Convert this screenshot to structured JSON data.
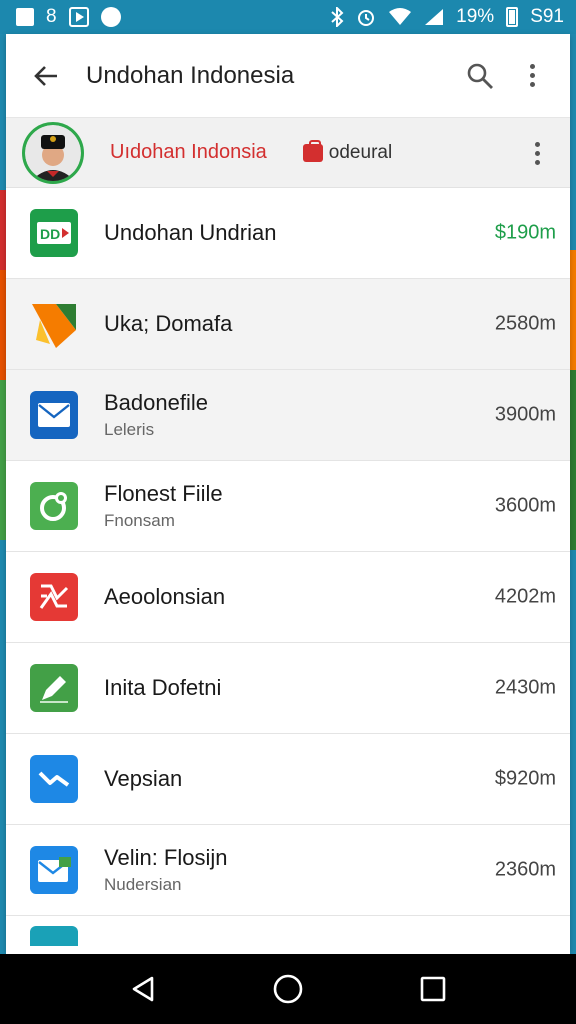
{
  "status_bar": {
    "left_text": "8",
    "battery_text": "19%",
    "time": "S91"
  },
  "toolbar": {
    "title": "Undohan Indonesia",
    "back_icon": "arrow-left-icon",
    "search_icon": "search-icon",
    "more_icon": "more-vert-icon"
  },
  "account": {
    "name": "Uıdohan Indonsia",
    "storage_label": "odeural",
    "accent": "#d32f2f"
  },
  "items": [
    {
      "name": "Undohan Undrian",
      "sub": "",
      "size": "$190m",
      "icon": "dd-logo-icon",
      "color": "#1e9e4a"
    },
    {
      "name": "Uka; Domafa",
      "sub": "",
      "size": "2580m",
      "icon": "drive-folder-icon",
      "color": "#f57c00"
    },
    {
      "name": "Badonefile",
      "sub": "Leleris",
      "size": "3900m",
      "icon": "mail-icon",
      "color": "#1565c0"
    },
    {
      "name": "Flonest Fiile",
      "sub": "Fnonsam",
      "size": "3600m",
      "icon": "leaf-icon",
      "color": "#4caf50"
    },
    {
      "name": "Aeoolonsian",
      "sub": "",
      "size": "4202m",
      "icon": "ribbon-icon",
      "color": "#e53935"
    },
    {
      "name": "Inita Dofetni",
      "sub": "",
      "size": "2430m",
      "icon": "edit-icon",
      "color": "#43a047"
    },
    {
      "name": "Vepsian",
      "sub": "",
      "size": "$920m",
      "icon": "wave-mail-icon",
      "color": "#1e88e5"
    },
    {
      "name": "Velin: Flosijn",
      "sub": "Nudersian",
      "size": "2360m",
      "icon": "mail-badge-icon",
      "color": "#1e88e5"
    }
  ],
  "nav": {
    "back": "nav-back-icon",
    "home": "nav-home-icon",
    "recents": "nav-recents-icon"
  }
}
